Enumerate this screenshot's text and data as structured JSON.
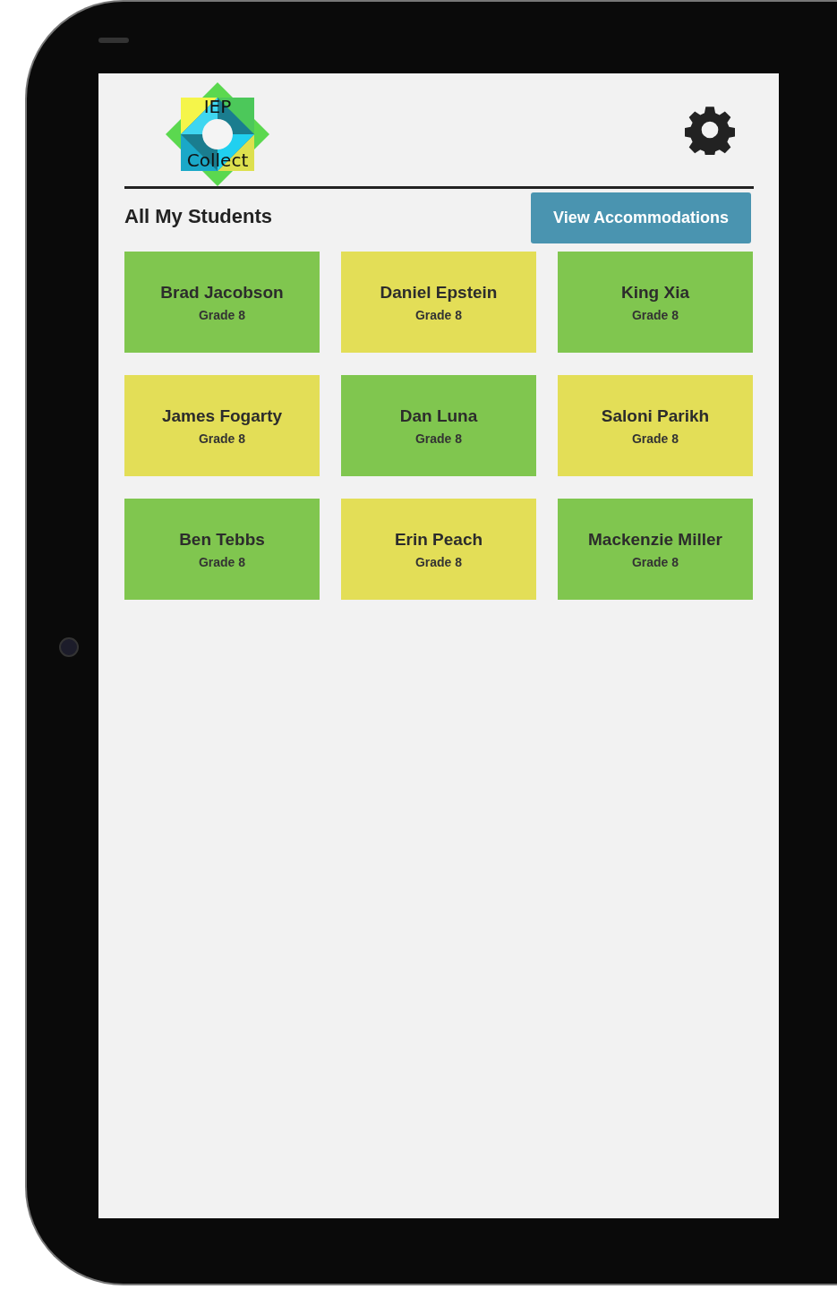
{
  "logo": {
    "top_text": "IEP",
    "bottom_text": "Collect"
  },
  "title": "All My Students",
  "action_button": "View Accommodations",
  "students": [
    {
      "name": "Brad Jacobson",
      "grade": "Grade 8",
      "color": "#80c64f"
    },
    {
      "name": "Daniel Epstein",
      "grade": "Grade 8",
      "color": "#e3de57"
    },
    {
      "name": "King Xia",
      "grade": "Grade 8",
      "color": "#80c64f"
    },
    {
      "name": "James Fogarty",
      "grade": "Grade 8",
      "color": "#e3de57"
    },
    {
      "name": "Dan Luna",
      "grade": "Grade 8",
      "color": "#80c64f"
    },
    {
      "name": "Saloni Parikh",
      "grade": "Grade 8",
      "color": "#e3de57"
    },
    {
      "name": "Ben Tebbs",
      "grade": "Grade 8",
      "color": "#80c64f"
    },
    {
      "name": "Erin Peach",
      "grade": "Grade 8",
      "color": "#e3de57"
    },
    {
      "name": "Mackenzie Miller",
      "grade": "Grade 8",
      "color": "#80c64f"
    }
  ]
}
